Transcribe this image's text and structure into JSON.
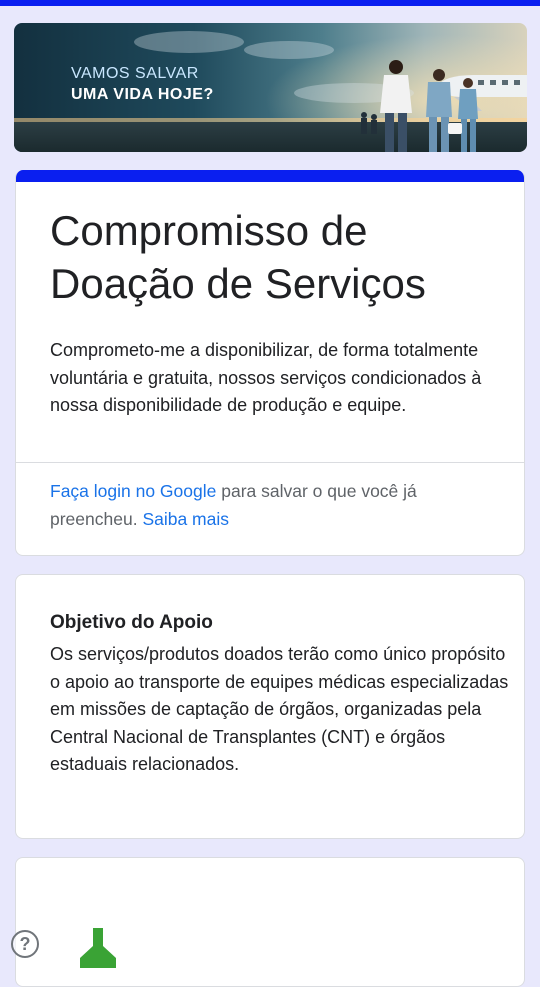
{
  "banner": {
    "line1": "VAMOS SALVAR",
    "line2": "UMA VIDA HOJE?"
  },
  "form": {
    "title": "Compromisso de Doação de Serviços",
    "description": "Comprometo-me a disponibilizar, de forma totalmente voluntária e gratuita, nossos serviços condicionados à nossa disponibilidade de produção e equipe.",
    "login_link": "Faça login no Google",
    "login_text": " para salvar o que você já preencheu. ",
    "learn_more": "Saiba mais"
  },
  "objective": {
    "title": "Objetivo do Apoio",
    "body": "Os serviços/produtos doados terão como único propósito o apoio ao transporte de equipes médicas especializadas em missões de captação de órgãos, organizadas pela Central Nacional de Transplantes (CNT) e órgãos estaduais relacionados."
  },
  "help": {
    "label": "?"
  },
  "colors": {
    "accent": "#0a1ff0",
    "background": "#e8e8fc",
    "link": "#1a73e8",
    "icon_green": "#3aa335"
  },
  "icons": {
    "help": "help-icon",
    "next_section": "green-arrow-icon"
  }
}
